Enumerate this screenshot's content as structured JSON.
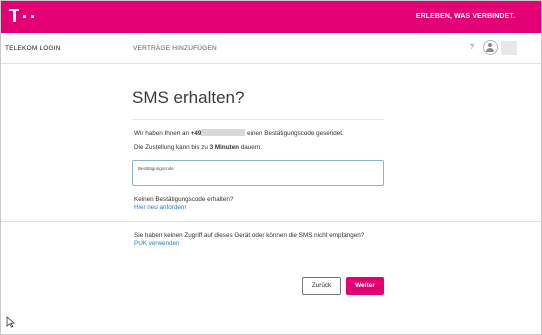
{
  "header": {
    "logo": "T ··",
    "slogan": "ERLEBEN, WAS VERBINDET."
  },
  "nav": {
    "login": "TELEKOM LOGIN",
    "contracts": "VERTRÄGE HINZUFÜGEN",
    "help": "?"
  },
  "main": {
    "title": "SMS erhalten?",
    "sent_prefix": "Wir haben Ihnen an ",
    "phone_prefix": "+49",
    "sent_suffix": " einen Bestätigungscode gesendet.",
    "delivery_prefix": "Die Zustellung kann bis zu ",
    "delivery_bold": "3 Minuten",
    "delivery_suffix": " dauern.",
    "code_field_label": "Bestätigungscode",
    "code_field_value": "",
    "no_code_question": "Keinen Bestätigungscode erhalten?",
    "resend_link": "Hier neu anfordern",
    "no_access_question": "Sie haben keinen Zugriff auf dieses Gerät oder können die SMS nicht empfangen?",
    "puk_link": "PUK verwenden"
  },
  "actions": {
    "back_label": "Zurück",
    "next_label": "Weiter"
  },
  "colors": {
    "brand": "#e20074",
    "link": "#2b7fb8"
  }
}
